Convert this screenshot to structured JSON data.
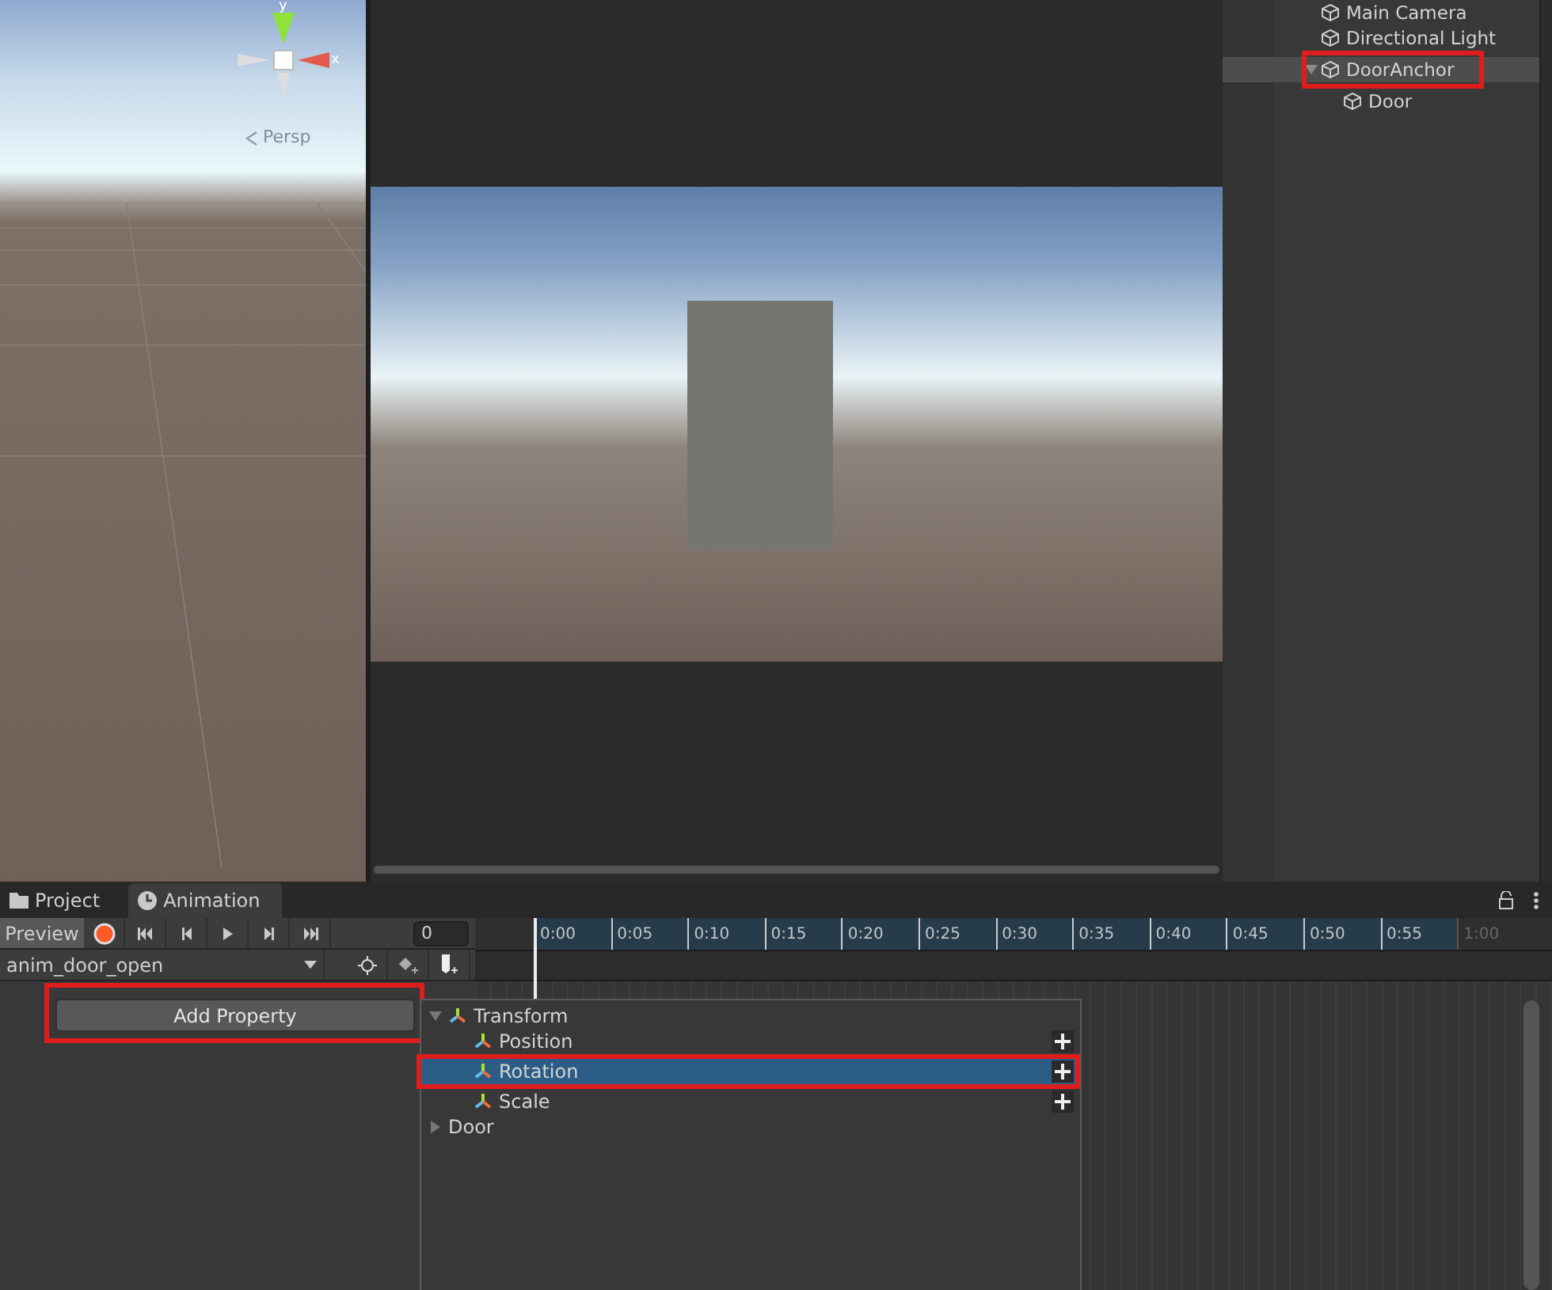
{
  "scene_view": {
    "axis_labels": [
      "y",
      "x"
    ],
    "projection": "Persp"
  },
  "hierarchy": {
    "items": [
      {
        "label": "Main Camera",
        "selected": false
      },
      {
        "label": "Directional Light",
        "selected": false
      },
      {
        "label": "DoorAnchor",
        "selected": true,
        "expanded": true,
        "highlighted": true,
        "children": [
          {
            "label": "Door",
            "selected": false
          }
        ]
      }
    ]
  },
  "tabs": [
    {
      "label": "Project",
      "selected": false,
      "kind": "folder"
    },
    {
      "label": "Animation",
      "selected": true,
      "kind": "clock"
    }
  ],
  "animation": {
    "preview": "Preview",
    "frame": "0",
    "clip": "anim_door_open",
    "add_property": "Add Property",
    "add_property_highlighted": true,
    "ruler": [
      {
        "label": "0:00",
        "disabled": false
      },
      {
        "label": "0:05",
        "disabled": false
      },
      {
        "label": "0:10",
        "disabled": false
      },
      {
        "label": "0:15",
        "disabled": false
      },
      {
        "label": "0:20",
        "disabled": false
      },
      {
        "label": "0:25",
        "disabled": false
      },
      {
        "label": "0:30",
        "disabled": false
      },
      {
        "label": "0:35",
        "disabled": false
      },
      {
        "label": "0:40",
        "disabled": false
      },
      {
        "label": "0:45",
        "disabled": false
      },
      {
        "label": "0:50",
        "disabled": false
      },
      {
        "label": "0:55",
        "disabled": false
      },
      {
        "label": "1:00",
        "disabled": true
      }
    ]
  },
  "property_popup": {
    "items": [
      {
        "label": "Transform",
        "expanded": true,
        "children": [
          {
            "label": "Position",
            "selected": false,
            "highlighted": false
          },
          {
            "label": "Rotation",
            "selected": true,
            "highlighted": true
          },
          {
            "label": "Scale",
            "selected": false,
            "highlighted": false
          }
        ]
      },
      {
        "label": "Door",
        "expanded": false
      }
    ]
  }
}
